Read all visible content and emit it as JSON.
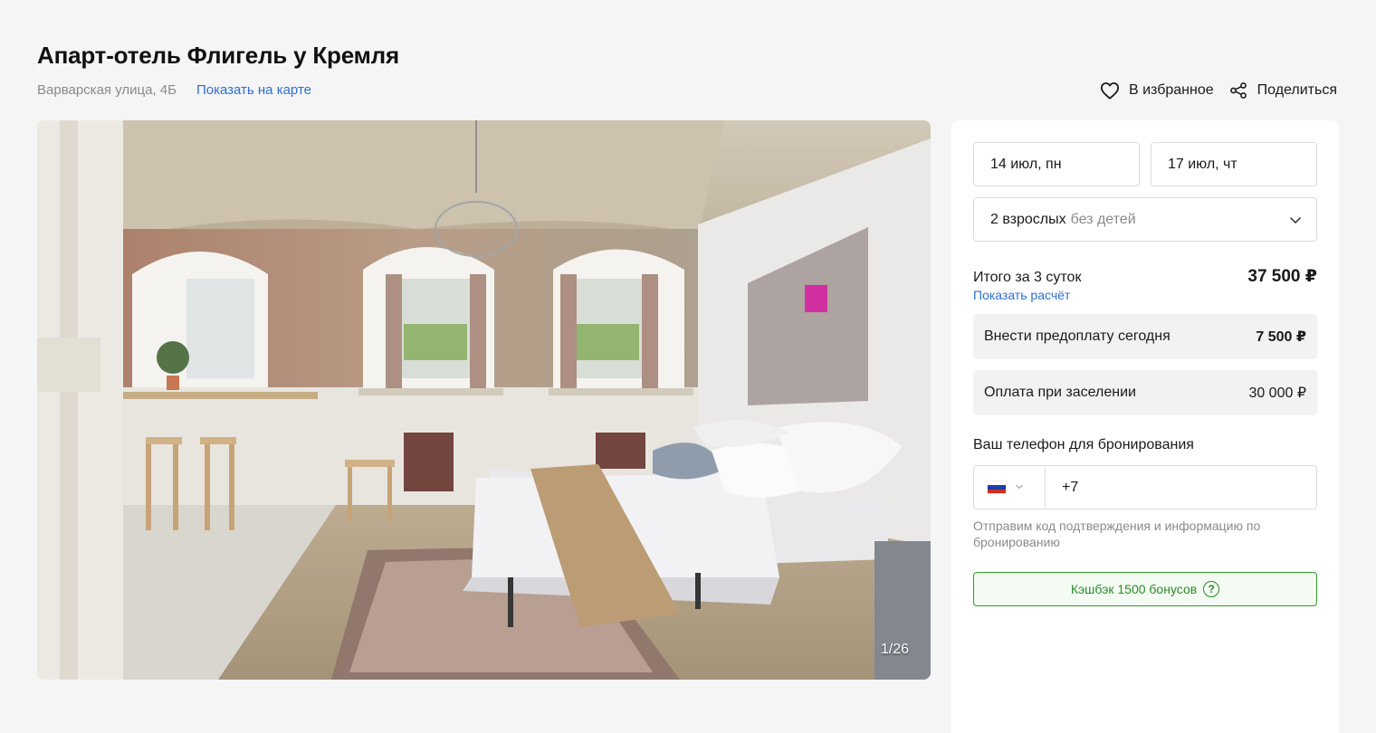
{
  "hotel": {
    "title": "Апарт-отель Флигель у Кремля",
    "address": "Варварская улица, 4Б",
    "map_link": "Показать на карте"
  },
  "actions": {
    "favorite_label": "В избранное",
    "favorite_icon": "heart-icon",
    "share_label": "Поделиться",
    "share_icon": "share-icon"
  },
  "gallery": {
    "counter": "1/26"
  },
  "booking": {
    "check_in": "14 июл, пн",
    "check_out": "17 июл, чт",
    "guests_main": "2 взрослых",
    "guests_muted": "без детей",
    "total_label": "Итого за 3 суток",
    "total_price": "37 500 ₽",
    "calc_link": "Показать расчёт",
    "prepay_label": "Внести предоплату сегодня",
    "prepay_amount": "7 500 ₽",
    "checkin_pay_label": "Оплата при заселении",
    "checkin_pay_amount": "30 000 ₽",
    "phone_label": "Ваш телефон для бронирования",
    "phone_prefix": "+7",
    "phone_note": "Отправим код подтверждения и информацию по бронированию",
    "cashback_label": "Кэшбэк 1500 бонусов",
    "cashback_help": "?"
  },
  "colors": {
    "link": "#2c6fd1",
    "cashback_green": "#2a8a2a",
    "background": "#f5f5f5"
  }
}
